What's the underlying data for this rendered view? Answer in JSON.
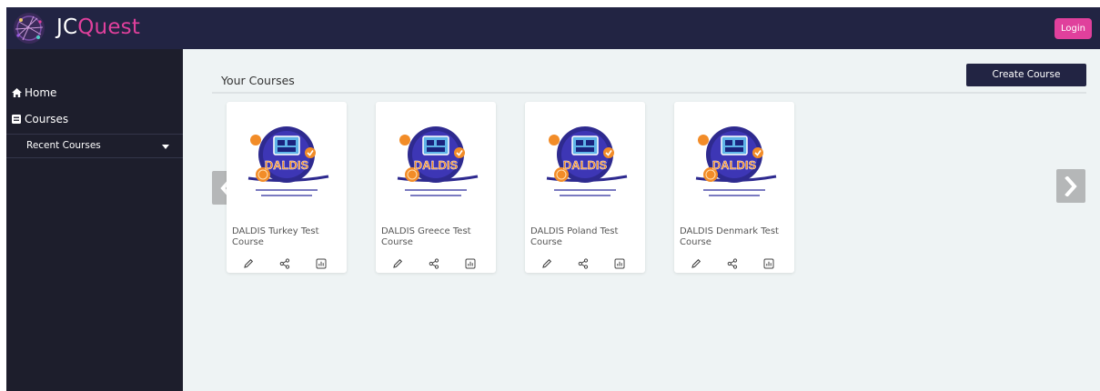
{
  "header": {
    "brand_prefix": "JC",
    "brand_suffix": "Quest",
    "login_label": "Login",
    "colors": {
      "bar": "#222443",
      "accent": "#e0409c"
    }
  },
  "sidebar": {
    "items": [
      {
        "label": "Home",
        "icon": "home-icon"
      },
      {
        "label": "Courses",
        "icon": "book-icon"
      }
    ],
    "submenu": {
      "label": "Recent Courses",
      "icon": "caret-down-icon"
    }
  },
  "main": {
    "title": "Your Courses",
    "create_label": "Create Course",
    "courses": [
      {
        "title": "DALDIS Turkey Test Course",
        "logo_text": "DALDIS"
      },
      {
        "title": "DALDIS Greece Test Course",
        "logo_text": "DALDIS"
      },
      {
        "title": "DALDIS Poland Test Course",
        "logo_text": "DALDIS"
      },
      {
        "title": "DALDIS Denmark Test Course",
        "logo_text": "DALDIS"
      }
    ],
    "card_actions": [
      "edit-icon",
      "share-icon",
      "stats-icon"
    ]
  }
}
